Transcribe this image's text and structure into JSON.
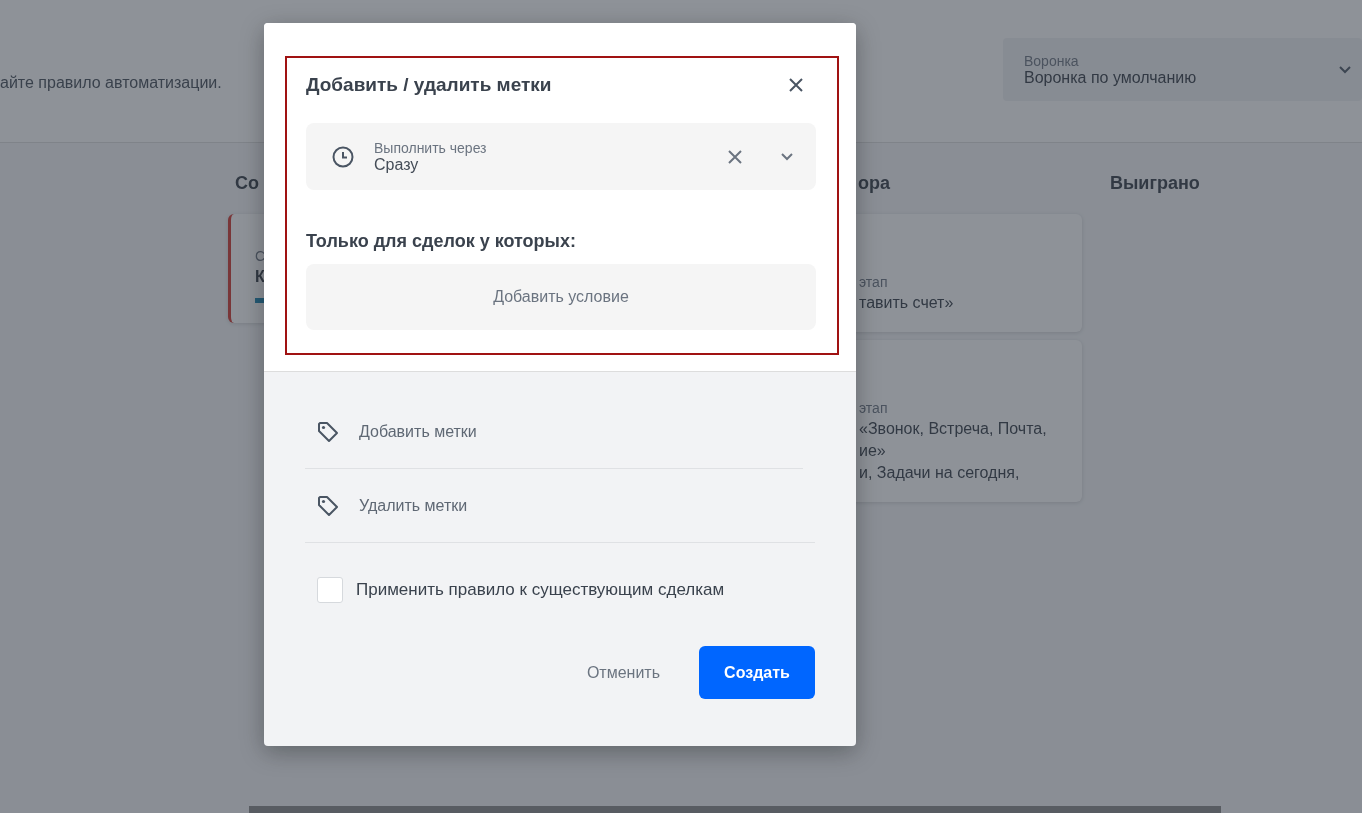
{
  "page": {
    "description": "айте правило автоматизации.",
    "funnel_select": {
      "label": "Воронка",
      "value": "Воронка по умолчанию"
    }
  },
  "columns": [
    {
      "title": "Со",
      "cards": [
        {
          "overdue": true,
          "bar": true,
          "lines": [
            {
              "kind": "label",
              "text": "С"
            },
            {
              "kind": "value",
              "text": "К"
            }
          ]
        }
      ]
    },
    {
      "title": "ора",
      "cards": [
        {
          "overdue": false,
          "bar": false,
          "lines": [
            {
              "kind": "label",
              "text": "этап"
            },
            {
              "kind": "value",
              "text": "тавить счет»"
            }
          ]
        },
        {
          "overdue": false,
          "bar": false,
          "lines": [
            {
              "kind": "label",
              "text": "этап"
            },
            {
              "kind": "value",
              "text": "«Звонок, Встреча, Почта,"
            },
            {
              "kind": "value",
              "text": "ие»"
            },
            {
              "kind": "value",
              "text": "и, Задачи на сегодня,"
            }
          ]
        }
      ]
    },
    {
      "title": "Выиграно"
    }
  ],
  "modal": {
    "highlighted": true,
    "title": "Добавить / удалить метки",
    "delay_select": {
      "label": "Выполнить через",
      "value": "Сразу"
    },
    "conditions_heading": "Только для сделок у которых:",
    "add_condition": "Добавить условие",
    "actions": [
      {
        "label": "Добавить метки"
      },
      {
        "label": "Удалить метки"
      }
    ],
    "apply_existing": {
      "label": "Применить правило к существующим сделкам",
      "checked": false
    },
    "buttons": [
      {
        "kind": "secondary",
        "label": "Отменить"
      },
      {
        "kind": "primary",
        "label": "Создать"
      }
    ]
  }
}
